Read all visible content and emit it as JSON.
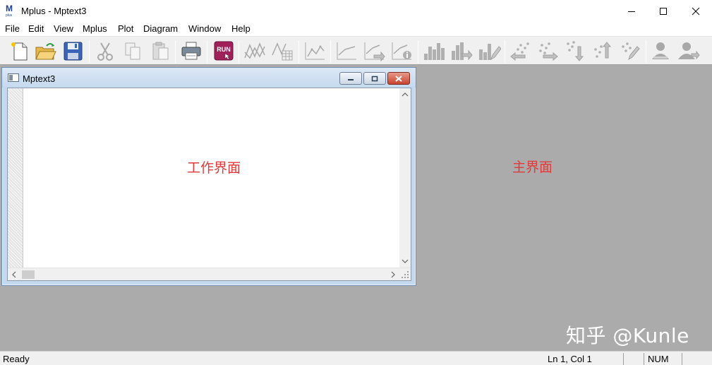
{
  "window": {
    "title": "Mplus - Mptext3",
    "logo_icon": "mplus-logo-icon",
    "controls": [
      "minimize-icon",
      "maximize-icon",
      "close-icon"
    ]
  },
  "menu": {
    "items": [
      "File",
      "Edit",
      "View",
      "Mplus",
      "Plot",
      "Diagram",
      "Window",
      "Help"
    ]
  },
  "toolbar": {
    "buttons": [
      "new-file-icon",
      "open-folder-icon",
      "save-icon",
      "cut-icon",
      "copy-icon",
      "paste-icon",
      "print-icon",
      "run-icon",
      "plot-lines-icon",
      "plot-table-icon",
      "plot-scatter-icon",
      "plot-line-icon",
      "plot-export-icon",
      "plot-info-icon",
      "bar-chart-icon",
      "bar-chart-arrow-icon",
      "bar-chart-edit-icon",
      "scatter-left-icon",
      "scatter-right-icon",
      "scatter-down-icon",
      "scatter-up-icon",
      "scatter-edit-icon",
      "user-icon",
      "user-arrow-icon"
    ],
    "run_label": "RUN"
  },
  "child_window": {
    "title": "Mptext3",
    "work_label": "工作界面"
  },
  "workspace": {
    "main_label": "主界面",
    "watermark": "知乎 @Kunle"
  },
  "status": {
    "ready": "Ready",
    "position": "Ln 1, Col 1",
    "num": "NUM"
  },
  "colors": {
    "workspace_bg": "#ababab",
    "annotation_red": "#e03a3a",
    "run_button": "#a0205a"
  }
}
